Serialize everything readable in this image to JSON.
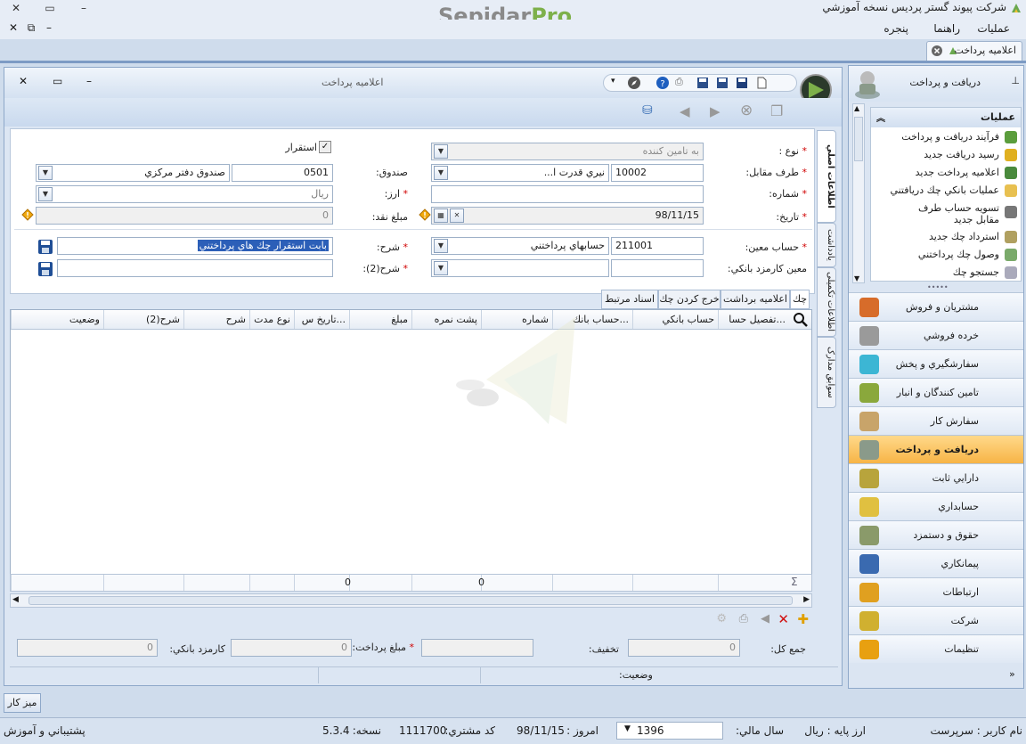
{
  "company": "شرکت پیوند گستر پردیس نسخه آموزشي",
  "logo": {
    "part1": "Sepidar",
    "part2": "Pro"
  },
  "menu": {
    "operations": "عملیات",
    "guide": "راهنما",
    "window": "پنجره"
  },
  "doc_tab": {
    "label": "اعلاميه پرداخت"
  },
  "form": {
    "title": "اعلاميه پرداخت",
    "fields": {
      "type_label": "نوع :",
      "type_value": "به تامين کننده",
      "counterparty_label": "طرف مقابل:",
      "counterparty_code": "10002",
      "counterparty_name": "نيري قدرت ا...",
      "number_label": "شماره:",
      "number_value": "",
      "date_label": "تاريخ:",
      "date_value": "98/11/15",
      "settle_label": "استقرار",
      "fund_label": "صندوق:",
      "fund_code": "0501",
      "fund_name": "صندوق دفتر مرکزي",
      "currency_label": "ارز:",
      "currency_value": "ريال",
      "cash_label": "مبلغ نقد:",
      "cash_value": "0",
      "account_label": "حساب معین:",
      "account_code": "211001",
      "account_name": "حسابهاي پرداختني",
      "bank_fee_label": "معين کارمزد بانکي:",
      "desc_label": "شرح:",
      "desc_value": "بابت استقرار چك هاي پرداختني",
      "desc2_label": "شرح(2):",
      "desc2_value": ""
    },
    "vtabs": [
      "اطلاعات اصلي",
      "یادداشت",
      "اطلاعات تکمیلی",
      "سوابق مدارک"
    ],
    "inner_tabs": [
      "چك",
      "اعلاميه برداشت",
      "خرج کردن چك",
      "اسناد مرتبط"
    ],
    "grid": {
      "columns": [
        "تفصيل حسا...",
        "حساب بانکي",
        "حساب بانك...",
        "شماره",
        "پشت نمره",
        "مبلغ",
        "تاريخ س...",
        "نوع مدت",
        "شرح",
        "شرح(2)",
        "وضعيت"
      ],
      "footer_amount": "0",
      "footer_back": "0"
    },
    "totals": {
      "total_label": "جمع کل:",
      "total_value": "0",
      "discount_label": "تخفيف:",
      "discount_value": "",
      "paid_label": "مبلغ پرداخت:",
      "paid_value": "0",
      "fee_label": "کارمزد بانکي:",
      "fee_value": "0"
    },
    "status_label": "وضعيت:"
  },
  "nav": {
    "header": "دریافت و پرداخت",
    "ops_title": "عملیات",
    "operations": [
      "فرآيند دريافت و پرداخت",
      "رسيد دريافت جديد",
      "اعلاميه پرداخت جديد",
      "عمليات بانکي چك دريافتني",
      "تسويه حساب طرف مقابل جديد",
      "استرداد چك جديد",
      "وصول چك پرداختني",
      "جستجو چك"
    ],
    "modules": [
      "مشتريان و فروش",
      "خرده فروشي",
      "سفارشگيري و پخش",
      "تامين کنندگان و انبار",
      "سفارش کار",
      "دريافت و پرداخت",
      "دارايي ثابت",
      "حسابداري",
      "حقوق و دستمزد",
      "پيمانکاري",
      "ارتباطات",
      "شرکت",
      "تنظيمات"
    ],
    "active_module": "دريافت و پرداخت"
  },
  "desk_button": "ميز کار",
  "status": {
    "username_label": "نام کاربر :",
    "username": "سرپرست",
    "base_currency_label": "ارز پایه :",
    "base_currency": "ريال",
    "fiscal_year_label": "سال مالي:",
    "fiscal_year": "1396",
    "today_label": "امروز :",
    "today": "98/11/15",
    "customer_code_label": "کد مشتري:",
    "customer_code": "1111700",
    "version_label": "نسخه:",
    "version": "5.3.4",
    "support": "پشتيباني و آموزش"
  },
  "colors": {
    "accent": "#f7b446",
    "frame": "#8ea8c9",
    "required": "#d00000",
    "logo_green": "#7db04a"
  }
}
